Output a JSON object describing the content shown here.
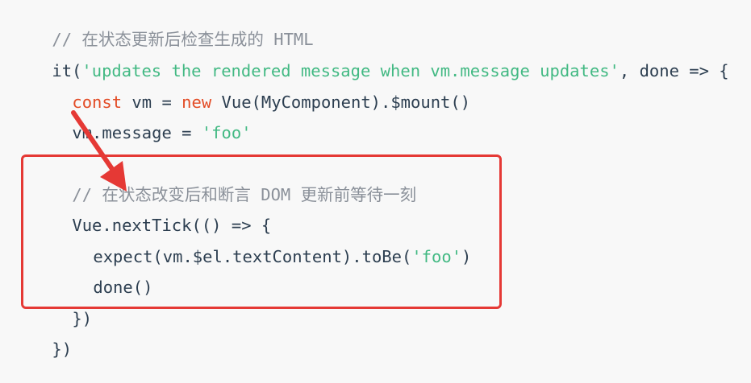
{
  "code": {
    "comment_top": "// 在状态更新后检查生成的 HTML",
    "it_call": "it(",
    "test_name": "'updates the rendered message when vm.message updates'",
    "it_tail": ", done => {",
    "const_kw": "const",
    "vm_decl_mid": " vm = ",
    "new_kw": "new",
    "vm_decl_tail": " Vue(MyComponent).$mount()",
    "assign_head": "vm.message = ",
    "assign_value": "'foo'",
    "comment_box": "// 在状态改变后和断言 DOM 更新前等待一刻",
    "nexttick_line": "Vue.nextTick(() => {",
    "expect_head": "expect(vm.$el.textContent).toBe(",
    "expect_value": "'foo'",
    "expect_tail": ")",
    "done_line": "done()",
    "inner_close": "})",
    "outer_close": "})"
  },
  "colors": {
    "background": "#f8f8f8",
    "text": "#2c3e50",
    "string": "#42b983",
    "keyword": "#e34c26",
    "comment": "#8a9099",
    "annotation": "#e53935"
  }
}
